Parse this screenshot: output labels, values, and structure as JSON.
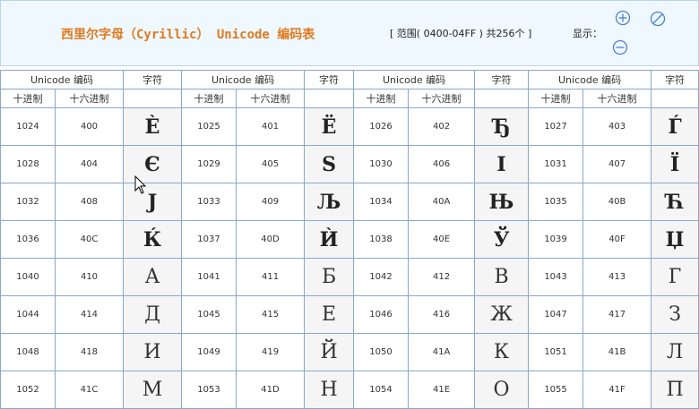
{
  "header": {
    "title": "西里尔字母（Cyrillic） Unicode 编码表",
    "range": "[ 范围( 0400-04FF ) 共256个 ]",
    "show_label": "显示：",
    "icons": [
      "zoom-in-icon",
      "reset-icon",
      "zoom-out-icon"
    ]
  },
  "table": {
    "group_header": "Unicode 编码",
    "char_header": "字符",
    "dec_header": "十进制",
    "hex_header": "十六进制",
    "rows": [
      [
        [
          "1024",
          "400",
          "Ѐ"
        ],
        [
          "1025",
          "401",
          "Ё"
        ],
        [
          "1026",
          "402",
          "Ђ"
        ],
        [
          "1027",
          "403",
          "Ѓ"
        ]
      ],
      [
        [
          "1028",
          "404",
          "Є"
        ],
        [
          "1029",
          "405",
          "Ѕ"
        ],
        [
          "1030",
          "406",
          "І"
        ],
        [
          "1031",
          "407",
          "Ї"
        ]
      ],
      [
        [
          "1032",
          "408",
          "Ј"
        ],
        [
          "1033",
          "409",
          "Љ"
        ],
        [
          "1034",
          "40A",
          "Њ"
        ],
        [
          "1035",
          "40B",
          "Ћ"
        ]
      ],
      [
        [
          "1036",
          "40C",
          "Ќ"
        ],
        [
          "1037",
          "40D",
          "Ѝ"
        ],
        [
          "1038",
          "40E",
          "Ў"
        ],
        [
          "1039",
          "40F",
          "Џ"
        ]
      ],
      [
        [
          "1040",
          "410",
          "А"
        ],
        [
          "1041",
          "411",
          "Б"
        ],
        [
          "1042",
          "412",
          "В"
        ],
        [
          "1043",
          "413",
          "Г"
        ]
      ],
      [
        [
          "1044",
          "414",
          "Д"
        ],
        [
          "1045",
          "415",
          "Е"
        ],
        [
          "1046",
          "416",
          "Ж"
        ],
        [
          "1047",
          "417",
          "З"
        ]
      ],
      [
        [
          "1048",
          "418",
          "И"
        ],
        [
          "1049",
          "419",
          "Й"
        ],
        [
          "1050",
          "41A",
          "К"
        ],
        [
          "1051",
          "41B",
          "Л"
        ]
      ],
      [
        [
          "1052",
          "41C",
          "М"
        ],
        [
          "1053",
          "41D",
          "Н"
        ],
        [
          "1054",
          "41E",
          "О"
        ],
        [
          "1055",
          "41F",
          "П"
        ]
      ]
    ]
  }
}
